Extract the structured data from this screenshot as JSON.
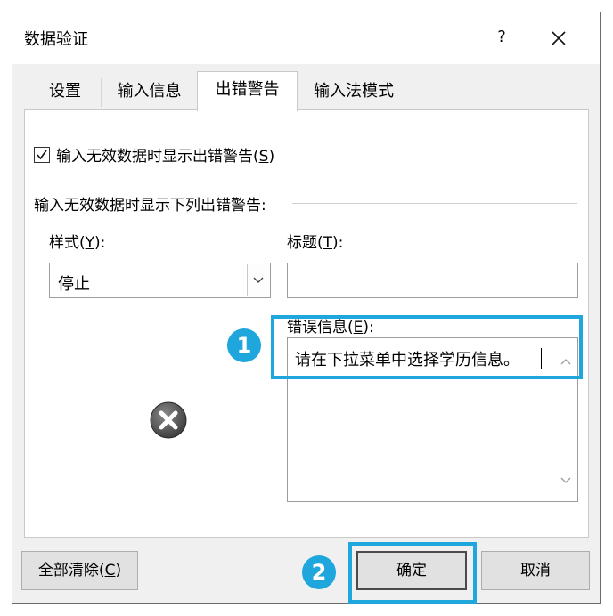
{
  "dialog": {
    "title": "数据验证",
    "help_label": "?"
  },
  "tabs": [
    {
      "label": "设置",
      "active": false
    },
    {
      "label": "输入信息",
      "active": false
    },
    {
      "label": "出错警告",
      "active": true
    },
    {
      "label": "输入法模式",
      "active": false
    }
  ],
  "error_alert": {
    "show_alert_checked": true,
    "show_alert_label": "输入无效数据时显示出错警告(",
    "show_alert_key": "S",
    "show_alert_suffix": ")",
    "group_title": "输入无效数据时显示下列出错警告:",
    "style_label": "样式(",
    "style_key": "Y",
    "style_suffix": "):",
    "style_value": "停止",
    "title_label": "标题(",
    "title_key": "T",
    "title_suffix": "):",
    "title_value": "",
    "message_label": "错误信息(",
    "message_key": "E",
    "message_suffix": "):",
    "message_value": "请在下拉菜单中选择学历信息。",
    "style_icon": "error-x-icon"
  },
  "callouts": [
    "1",
    "2"
  ],
  "buttons": {
    "clear_all": "全部清除(",
    "clear_all_key": "C",
    "clear_all_suffix": ")",
    "ok": "确定",
    "cancel": "取消"
  },
  "colors": {
    "highlight": "#1ea6dd",
    "dialog_bg": "#f0f0f0"
  }
}
